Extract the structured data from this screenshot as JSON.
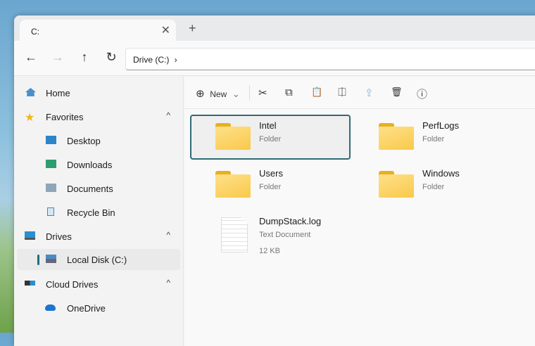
{
  "tab": {
    "title": "C:",
    "close": "✕",
    "new_tab": "+"
  },
  "nav": {
    "back": "←",
    "forward": "→",
    "up": "↑",
    "refresh": "↻",
    "breadcrumb": "Drive (C:)",
    "chevron": "›"
  },
  "sidebar": {
    "items": [
      {
        "label": "Home",
        "icon": "home-icon"
      },
      {
        "label": "Favorites",
        "icon": "star-icon",
        "chevron": "^"
      },
      {
        "label": "Desktop",
        "icon": "desktop-folder-icon"
      },
      {
        "label": "Downloads",
        "icon": "downloads-folder-icon"
      },
      {
        "label": "Documents",
        "icon": "documents-folder-icon"
      },
      {
        "label": "Recycle Bin",
        "icon": "recycle-bin-icon"
      },
      {
        "label": "Drives",
        "icon": "monitor-icon",
        "chevron": "^"
      },
      {
        "label": "Local Disk (C:)",
        "icon": "drive-icon"
      },
      {
        "label": "Cloud Drives",
        "icon": "cloud-drive-icon",
        "chevron": "^"
      },
      {
        "label": "OneDrive",
        "icon": "onedrive-icon"
      }
    ]
  },
  "toolbar": {
    "new_label": "New",
    "plus": "⊕",
    "caret": "⌄",
    "cut": "✂",
    "copy": "⧉",
    "paste": "📋",
    "rename": "⎅",
    "share": "⇪",
    "delete": "🗑",
    "info": "ⓘ"
  },
  "files": [
    {
      "name": "Intel",
      "type": "Folder"
    },
    {
      "name": "PerfLogs",
      "type": "Folder"
    },
    {
      "name": "Users",
      "type": "Folder"
    },
    {
      "name": "Windows",
      "type": "Folder"
    },
    {
      "name": "DumpStack.log",
      "type": "Text Document",
      "size": "12 KB"
    }
  ]
}
